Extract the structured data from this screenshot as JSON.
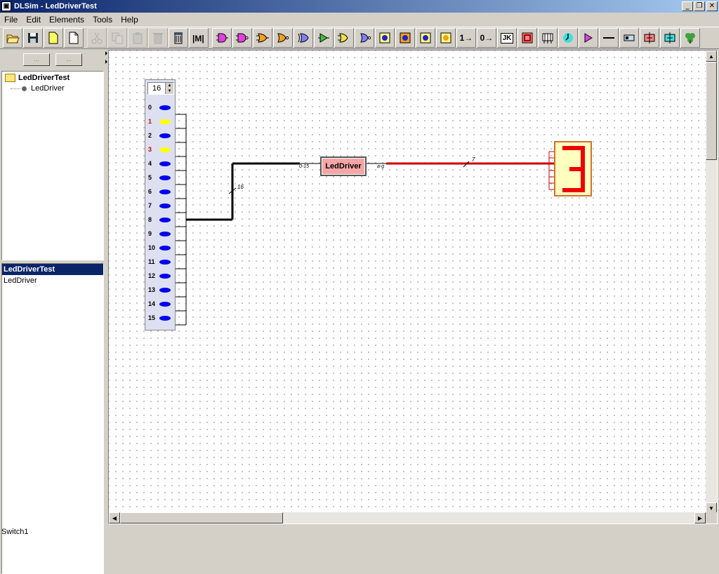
{
  "window": {
    "title": "DLSim - LedDriverTest",
    "minimize": "_",
    "maximize": "❐",
    "close": "✕"
  },
  "menu": [
    "File",
    "Edit",
    "Elements",
    "Tools",
    "Help"
  ],
  "toolbar": {
    "buttons": [
      "open-icon",
      "save-icon",
      "new-project-icon",
      "new-file-icon",
      "cut-icon",
      "copy-icon",
      "paste-icon",
      "delete-icon",
      "clear-icon",
      "compile-icon",
      "and-gate-icon",
      "nand-gate-icon",
      "or-gate-icon",
      "nor-gate-icon",
      "xor-gate-icon",
      "buffer-icon",
      "inverter-icon",
      "xnor-gate-icon",
      "led-blue-icon",
      "led-orange-icon",
      "led-blue2-icon",
      "led-orange2-icon",
      "constant-one-icon",
      "constant-zero-icon",
      "jk-flipflop-icon",
      "register-icon",
      "bus-icon",
      "clock-icon",
      "probe-icon",
      "wire-icon",
      "switch-icon",
      "splitter-icon",
      "merger-icon",
      "component-icon"
    ],
    "labels": {
      "const1": "1→",
      "const0": "0→",
      "jk": "JK"
    }
  },
  "left_panel": {
    "btn1": "...",
    "btn2": "...",
    "tree": {
      "root": "LedDriverTest",
      "child": "LedDriver"
    },
    "list": [
      "LedDriverTest",
      "LedDriver"
    ]
  },
  "circuit": {
    "switch_bank": {
      "count_value": "16",
      "bits": [
        {
          "label": "0",
          "on": false
        },
        {
          "label": "1",
          "on": true
        },
        {
          "label": "2",
          "on": false
        },
        {
          "label": "3",
          "on": true
        },
        {
          "label": "4",
          "on": false
        },
        {
          "label": "5",
          "on": false
        },
        {
          "label": "6",
          "on": false
        },
        {
          "label": "7",
          "on": false
        },
        {
          "label": "8",
          "on": false
        },
        {
          "label": "9",
          "on": false
        },
        {
          "label": "10",
          "on": false
        },
        {
          "label": "11",
          "on": false
        },
        {
          "label": "12",
          "on": false
        },
        {
          "label": "13",
          "on": false
        },
        {
          "label": "14",
          "on": false
        },
        {
          "label": "15",
          "on": false
        }
      ]
    },
    "bus_width_in": "16",
    "component": {
      "name": "LedDriver",
      "in_port": "0-15",
      "out_port": "a-g"
    },
    "bus_width_out": "7",
    "colors": {
      "off_led": "#0000ee",
      "on_led": "#ffff00",
      "on_label": "#cc0000",
      "active_wire": "#cc0000",
      "component_fill": "#f4a6a6",
      "display_fill": "#ffffc0",
      "segment": "#ee0000"
    }
  },
  "status": {
    "text": "Switch1"
  }
}
